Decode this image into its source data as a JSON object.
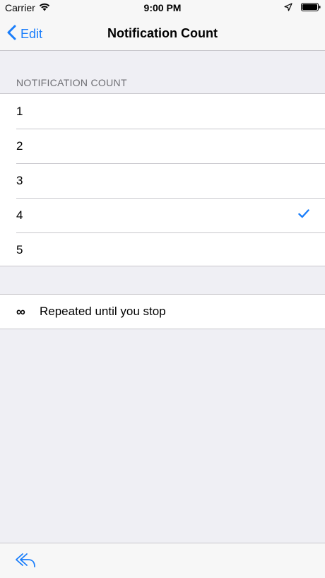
{
  "status_bar": {
    "carrier": "Carrier",
    "time": "9:00 PM",
    "icons": [
      "wifi-icon",
      "location-icon",
      "battery-icon"
    ]
  },
  "nav": {
    "back_label": "Edit",
    "title": "Notification Count",
    "back_icon": "chevron-left-icon"
  },
  "section": {
    "header": "NOTIFICATION COUNT",
    "options": [
      {
        "label": "1",
        "selected": false
      },
      {
        "label": "2",
        "selected": false
      },
      {
        "label": "3",
        "selected": false
      },
      {
        "label": "4",
        "selected": true
      },
      {
        "label": "5",
        "selected": false
      }
    ]
  },
  "repeat": {
    "symbol": "∞",
    "label": "Repeated until you stop"
  },
  "toolbar": {
    "reply_icon": "reply-icon"
  },
  "colors": {
    "accent": "#1a7efb",
    "background": "#efeff4",
    "separator": "#c8c7cc",
    "header_text": "#6d6d72"
  }
}
